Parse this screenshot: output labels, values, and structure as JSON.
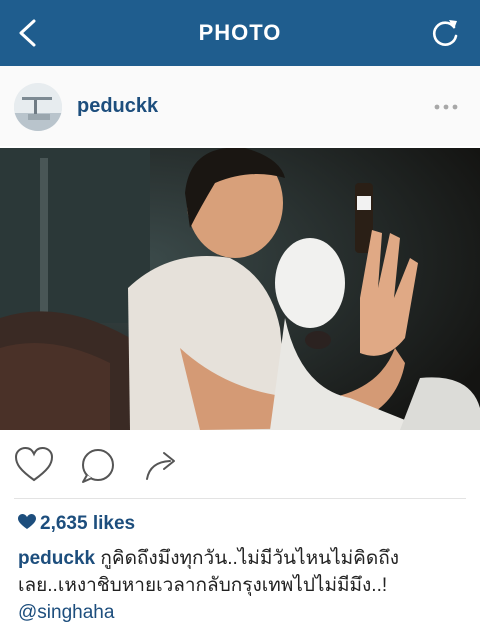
{
  "topbar": {
    "title": "PHOTO",
    "back_icon": "chevron-left-icon",
    "refresh_icon": "refresh-icon",
    "background": "#1f5d8e"
  },
  "post": {
    "username": "peduckk",
    "more_icon": "more-dots-icon"
  },
  "actions": {
    "like_icon": "heart-outline-icon",
    "comment_icon": "comment-bubble-icon",
    "share_icon": "share-arrow-icon"
  },
  "likes": {
    "text": "2,635 likes",
    "icon": "heart-filled-icon"
  },
  "caption": {
    "username": "peduckk",
    "text_line1": " กูคิดถึงมึงทุกวัน..ไม่มีวันไหนไม่คิดถึง",
    "text_line2": "เลย..เหงาชิบหายเวลากลับกรุงเทพไปไม่มีมึง..!",
    "mention": "@singhaha"
  },
  "colors": {
    "accent": "#1d4e7d",
    "header_bg": "#fafafa"
  }
}
